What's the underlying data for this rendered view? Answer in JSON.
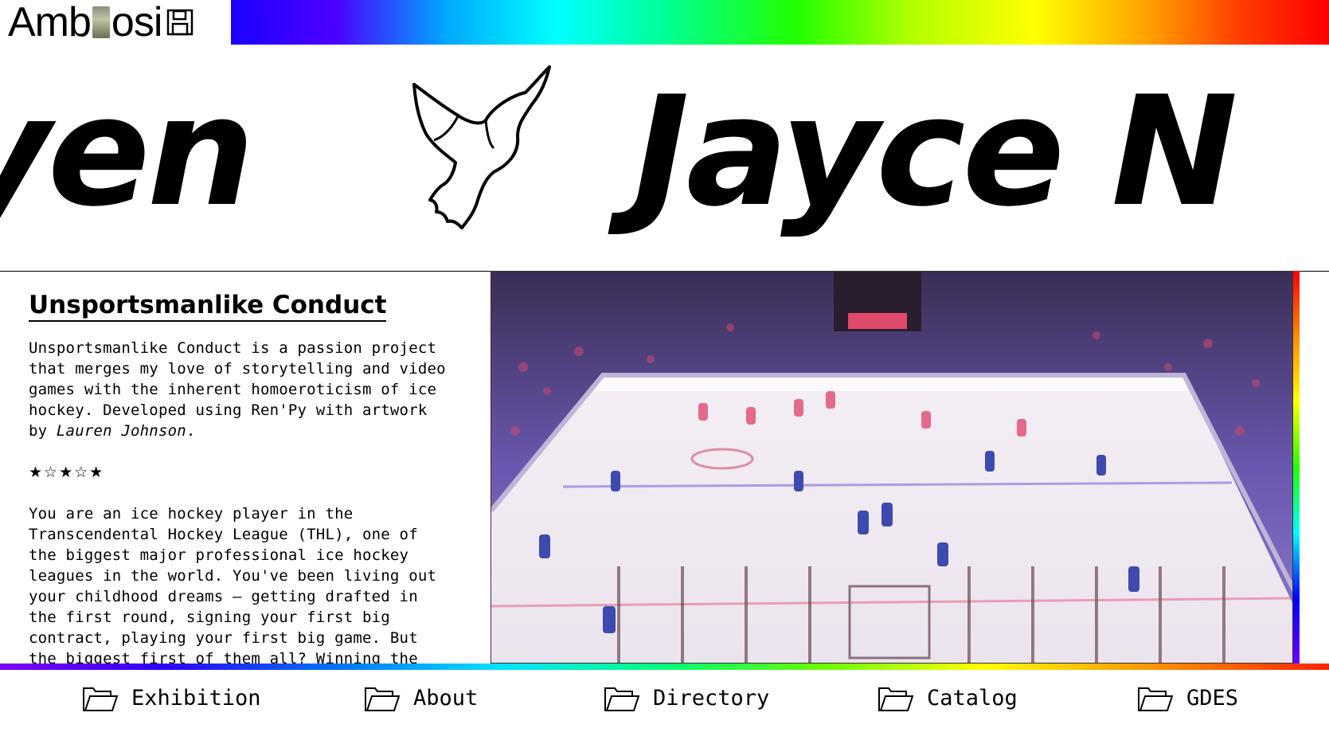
{
  "header": {
    "logo_text_left": "Amb",
    "logo_text_right": "osi",
    "logo_icon": "floppy-disk-icon"
  },
  "marquee": {
    "left_text": "yen",
    "right_text": "Jayce N",
    "separator_icon": "dove-icon"
  },
  "project": {
    "title": "Unsportsmanlike Conduct",
    "description": "Unsportsmanlike Conduct is a passion project that merges my love of storytelling and video games with the inherent homoeroticism of ice hockey. Developed using Ren'Py with artwork by",
    "artist": "Lauren Johnson",
    "artist_suffix": ".",
    "stars": "★☆★☆★",
    "body": "You are an ice hockey player in the Transcendental Hockey League (THL), one of the biggest major professional ice hockey leagues in the world. You've been living out your childhood dreams — getting drafted in the first round, signing your first big contract, playing your first big game. But the biggest first of them all? Winning the Amari Cup with the Phantoms."
  },
  "image": {
    "alt": "ice-hockey-arena-image"
  },
  "nav": {
    "items": [
      {
        "label": "Exhibition",
        "icon": "folder-icon"
      },
      {
        "label": "About",
        "icon": "folder-icon"
      },
      {
        "label": "Directory",
        "icon": "folder-icon"
      },
      {
        "label": "Catalog",
        "icon": "folder-icon"
      },
      {
        "label": "GDES",
        "icon": "folder-icon"
      }
    ]
  },
  "colors": {
    "text": "#000000",
    "background": "#ffffff",
    "rink_ice": "#eeeaf0",
    "stands": "#5a4a9a"
  }
}
